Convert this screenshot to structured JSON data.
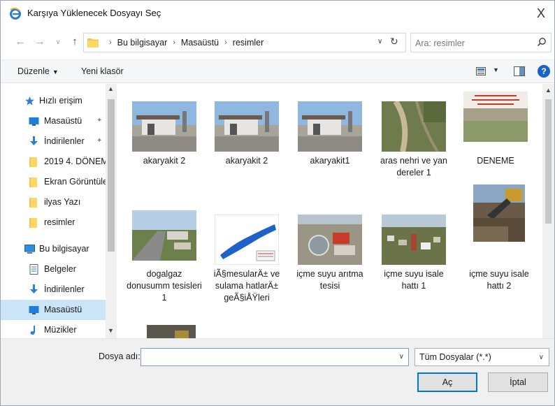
{
  "window": {
    "title": "Karşıya Yüklenecek Dosyayı Seç",
    "close_glyph": "X"
  },
  "address": {
    "crumbs": [
      "Bu bilgisayar",
      "Masaüstü",
      "resimler"
    ]
  },
  "search": {
    "placeholder": "Ara: resimler"
  },
  "toolbar": {
    "organize_label": "Düzenle",
    "new_folder_label": "Yeni klasör",
    "help_glyph": "?"
  },
  "sidebar": {
    "items": [
      {
        "label": "Hızlı erişim",
        "icon": "star-icon",
        "pinned": false,
        "level": 0
      },
      {
        "label": "Masaüstü",
        "icon": "desktop-icon",
        "pinned": true,
        "level": 1
      },
      {
        "label": "İndirilenler",
        "icon": "download-icon",
        "pinned": true,
        "level": 1
      },
      {
        "label": "2019  4. DÖNEM",
        "icon": "folder-icon",
        "pinned": false,
        "level": 1
      },
      {
        "label": "Ekran Görüntüle",
        "icon": "folder-icon",
        "pinned": false,
        "level": 1
      },
      {
        "label": "ilyas Yazı",
        "icon": "folder-icon",
        "pinned": false,
        "level": 1
      },
      {
        "label": "resimler",
        "icon": "folder-icon",
        "pinned": false,
        "level": 1
      },
      {
        "label": "Bu bilgisayar",
        "icon": "computer-icon",
        "pinned": false,
        "level": 0
      },
      {
        "label": "Belgeler",
        "icon": "documents-icon",
        "pinned": false,
        "level": 1
      },
      {
        "label": "İndirilenler",
        "icon": "download-icon",
        "pinned": false,
        "level": 1
      },
      {
        "label": "Masaüstü",
        "icon": "desktop-icon",
        "pinned": false,
        "level": 1,
        "selected": true
      },
      {
        "label": "Müzikler",
        "icon": "music-icon",
        "pinned": false,
        "level": 1
      }
    ]
  },
  "files": [
    {
      "name": "akaryakit 2",
      "thumb": "station"
    },
    {
      "name": "akaryakit 2",
      "thumb": "station"
    },
    {
      "name": "akaryakit1",
      "thumb": "station"
    },
    {
      "name": "aras nehri ve yan dereler 1",
      "thumb": "river"
    },
    {
      "name": "DENEME",
      "thumb": "document"
    },
    {
      "name": "dogalgaz donusumm tesisleri 1",
      "thumb": "road"
    },
    {
      "name": "iÃ§mesularÄ± ve sulama hatlarÄ± geÃ§iÅŸleri",
      "thumb": "map"
    },
    {
      "name": "içme suyu arıtma tesisi",
      "thumb": "plant"
    },
    {
      "name": "içme suyu isale hattı 1",
      "thumb": "town"
    },
    {
      "name": "içme suyu isale hattı 2",
      "thumb": "excavator"
    },
    {
      "name": "",
      "thumb": "dark"
    }
  ],
  "footer": {
    "filename_label": "Dosya adı:",
    "filename_value": "",
    "filetype_value": "Tüm Dosyalar (*.*)",
    "open_label": "Aç",
    "cancel_label": "İptal"
  }
}
